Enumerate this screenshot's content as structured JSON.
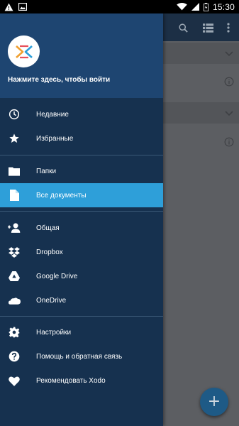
{
  "status_bar": {
    "time": "15:30",
    "left_icons": [
      "warning-icon",
      "image-icon"
    ],
    "right_icons": [
      "wifi-icon",
      "signal-icon",
      "battery-icon"
    ]
  },
  "toolbar": {
    "icons": [
      "search-icon",
      "view-list-icon",
      "more-vert-icon"
    ]
  },
  "drawer": {
    "header": {
      "login_prompt": "Нажмите здесь, чтобы войти",
      "logo": "xodo-logo"
    },
    "sections": [
      {
        "items": [
          {
            "label": "Недавние",
            "icon": "clock-icon",
            "active": false
          },
          {
            "label": "Избранные",
            "icon": "star-icon",
            "active": false
          }
        ]
      },
      {
        "items": [
          {
            "label": "Папки",
            "icon": "folder-icon",
            "active": false
          },
          {
            "label": "Все документы",
            "icon": "document-icon",
            "active": true
          }
        ]
      },
      {
        "items": [
          {
            "label": "Общая",
            "icon": "person-add-icon",
            "active": false
          },
          {
            "label": "Dropbox",
            "icon": "dropbox-icon",
            "active": false
          },
          {
            "label": "Google Drive",
            "icon": "google-drive-icon",
            "active": false
          },
          {
            "label": "OneDrive",
            "icon": "onedrive-icon",
            "active": false
          }
        ]
      },
      {
        "items": [
          {
            "label": "Настройки",
            "icon": "settings-icon",
            "active": false
          },
          {
            "label": "Помощь и обратная связь",
            "icon": "help-icon",
            "active": false
          },
          {
            "label": "Рекомендовать Xodo",
            "icon": "heart-icon",
            "active": false
          }
        ]
      }
    ]
  },
  "fab": {
    "icon": "add-icon",
    "symbol": "+"
  },
  "colors": {
    "drawer_bg": "#16314f",
    "drawer_header_bg": "#1e4571",
    "active_item_bg": "#2e9fd9",
    "toolbar_bg": "#1c2f45",
    "fab_bg": "#1e5a86"
  }
}
